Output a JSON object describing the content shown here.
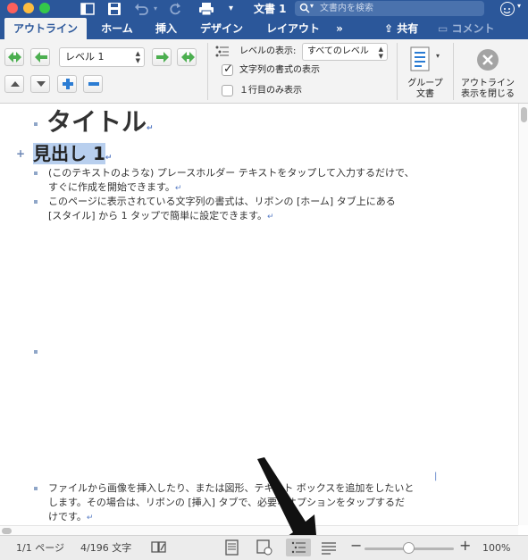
{
  "window": {
    "title": "文書 1",
    "search_placeholder": "文書内を検索"
  },
  "tabs": [
    {
      "label": "アウトライン",
      "active": true
    },
    {
      "label": "ホーム"
    },
    {
      "label": "挿入"
    },
    {
      "label": "デザイン"
    },
    {
      "label": "レイアウト"
    },
    {
      "label": "»"
    }
  ],
  "ribbon_right": {
    "share_label": "共有",
    "comment_label": "コメント"
  },
  "ribbon": {
    "level_value": "レベル 1",
    "show_level_label": "レベルの表示:",
    "show_level_value": "すべてのレベル",
    "show_formatting_label": "文字列の書式の表示",
    "show_formatting_checked": true,
    "first_line_only_label": "１行目のみ表示",
    "first_line_only_checked": false,
    "group_doc_label_1": "グループ",
    "group_doc_label_2": "文書",
    "close_outline_label_1": "アウトライン",
    "close_outline_label_2": "表示を閉じる"
  },
  "document": {
    "title": "タイトル",
    "heading": "見出し 1",
    "para1_line1": "(このテキストのような) プレースホルダー  テキストをタップして入力するだけで、",
    "para1_line2": "すぐに作成を開始できます。",
    "para2_line1": "このページに表示されている文字列の書式は、リボンの [ホーム] タブ上にある",
    "para2_line2": "[スタイル] から 1 タップで簡単に設定できます。",
    "para3_line1": "ファイルから画像を挿入したり、または図形、テキスト ボックスを追加をしたいと",
    "para3_line2": "します。その場合は、リボンの [挿入] タブで、必要なオプションをタップするだ",
    "para3_line3": "けです。",
    "para_mark": "↵"
  },
  "status": {
    "page": "1/1 ページ",
    "words": "4/196 文字",
    "zoom": "100%",
    "zoom_level": 1.0
  },
  "colors": {
    "ribbon_blue": "#2b579a",
    "heading_highlight": "#b8cfee",
    "nav_green": "#4caf50",
    "nav_blue": "#2b7cd3"
  }
}
